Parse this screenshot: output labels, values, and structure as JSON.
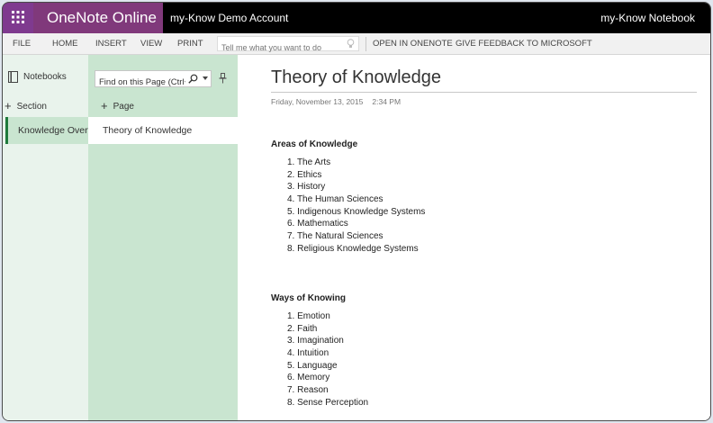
{
  "titlebar": {
    "app_name": "OneNote Online",
    "account": "my-Know Demo Account",
    "notebook": "my-Know Notebook"
  },
  "ribbon": {
    "tabs": [
      "FILE",
      "HOME",
      "INSERT",
      "VIEW",
      "PRINT"
    ],
    "tell_me_placeholder": "Tell me what you want to do",
    "open_in_onenote": "OPEN IN ONENOTE",
    "feedback": "GIVE FEEDBACK TO MICROSOFT"
  },
  "nav": {
    "notebooks_label": "Notebooks",
    "add_section_label": "Section",
    "sections": [
      {
        "label": "Knowledge Overv"
      }
    ]
  },
  "pages_panel": {
    "search_value": "Find on this Page (Ctrl+F)",
    "add_page_label": "Page",
    "pages": [
      {
        "label": "Theory of Knowledge"
      }
    ]
  },
  "page": {
    "title": "Theory of Knowledge",
    "date": "Friday, November 13, 2015",
    "time": "2:34 PM",
    "sections": [
      {
        "heading": "Areas of Knowledge",
        "items": [
          "The Arts",
          "Ethics",
          "History",
          "The Human Sciences",
          "Indigenous Knowledge Systems",
          "Mathematics",
          "The Natural Sciences",
          "Religious Knowledge Systems"
        ]
      },
      {
        "heading": "Ways of Knowing",
        "items": [
          "Emotion",
          "Faith",
          "Imagination",
          "Intuition",
          "Language",
          "Memory",
          "Reason",
          "Sense Perception"
        ]
      }
    ]
  },
  "colors": {
    "brand_purple": "#80397b",
    "titlebar": "#000000",
    "nav_bg": "#e9f3ec",
    "pages_bg": "#c9e5d0",
    "section_accent": "#1f7a3c"
  }
}
